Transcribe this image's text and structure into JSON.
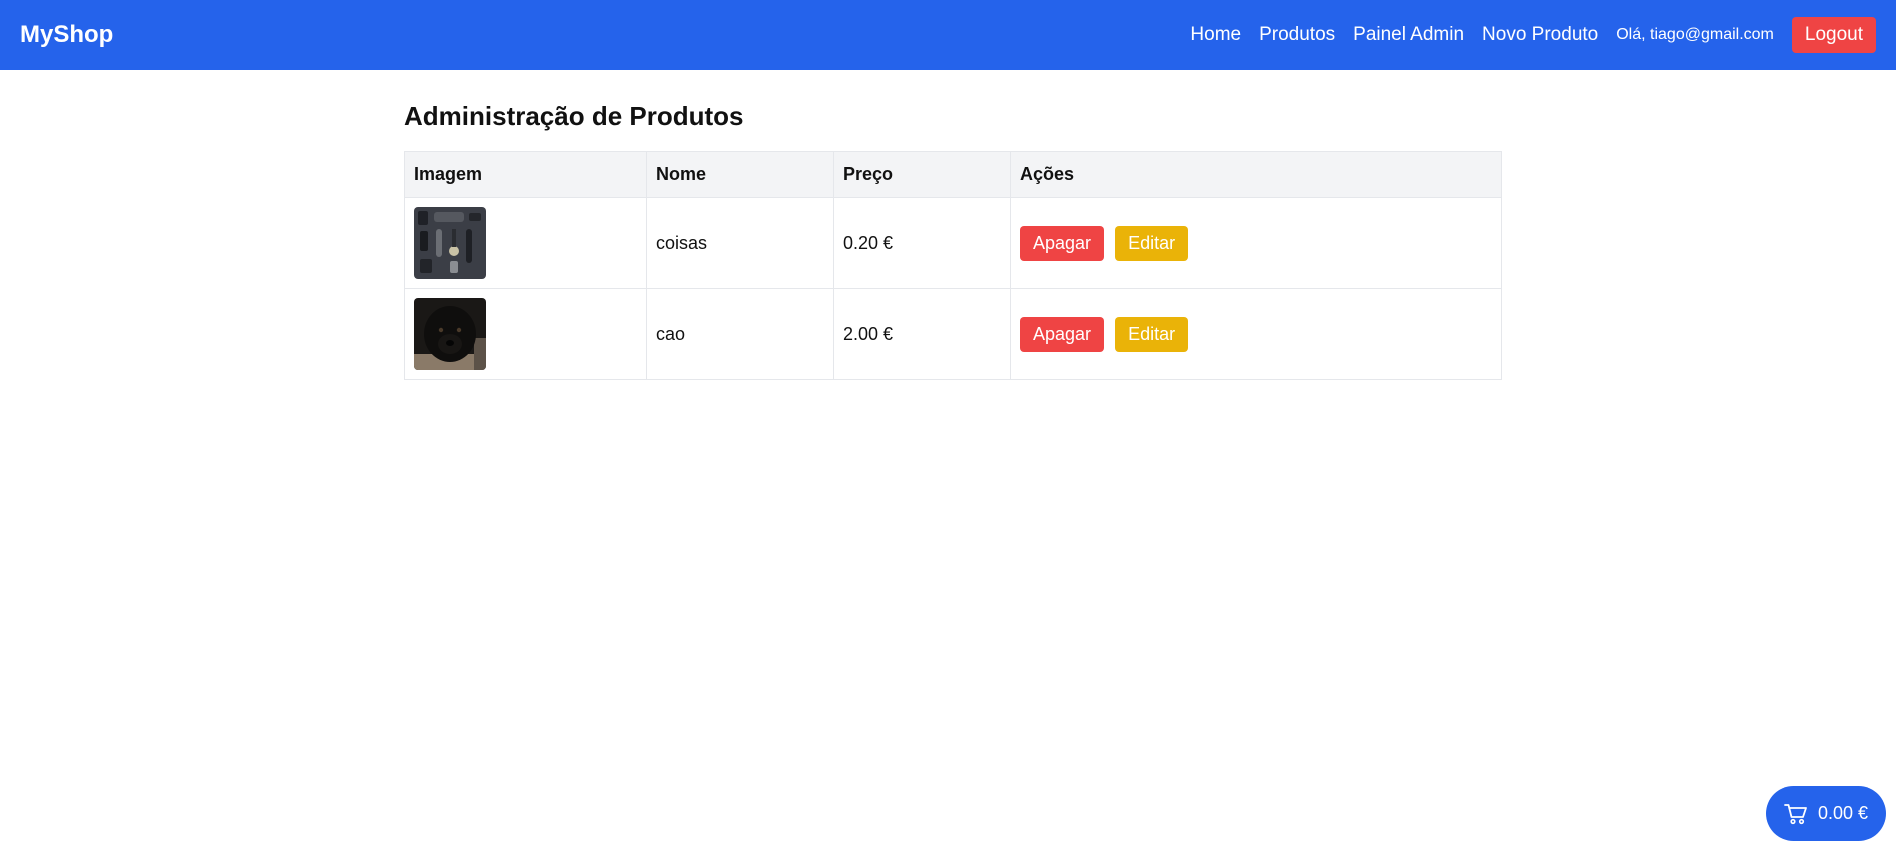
{
  "navbar": {
    "brand": "MyShop",
    "links": [
      "Home",
      "Produtos",
      "Painel Admin",
      "Novo Produto"
    ],
    "greeting": "Olá, tiago@gmail.com",
    "logout_label": "Logout"
  },
  "page": {
    "title": "Administração de Produtos"
  },
  "table": {
    "headers": [
      "Imagem",
      "Nome",
      "Preço",
      "Ações"
    ],
    "rows": [
      {
        "image": "products-flatlay-thumbnail",
        "name": "coisas",
        "price": "0.20 €",
        "delete_label": "Apagar",
        "edit_label": "Editar"
      },
      {
        "image": "black-dog-thumbnail",
        "name": "cao",
        "price": "2.00 €",
        "delete_label": "Apagar",
        "edit_label": "Editar"
      }
    ]
  },
  "cart": {
    "icon": "cart-icon",
    "total": "0.00 €"
  },
  "colors": {
    "primary": "#2563eb",
    "danger": "#ef4444",
    "warning": "#eab308"
  }
}
